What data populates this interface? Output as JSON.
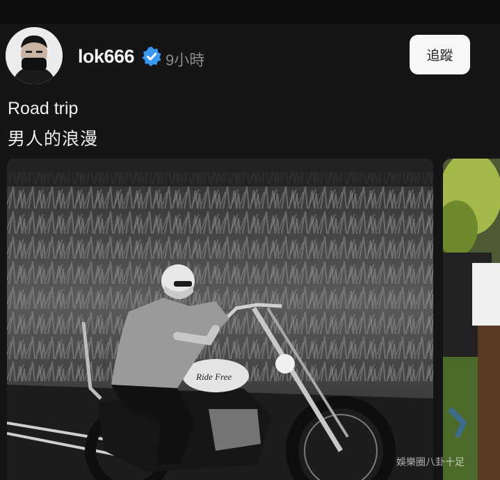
{
  "post": {
    "username": "lok666",
    "timestamp": "9小時",
    "follow_label": "追蹤",
    "caption_line1": "Road trip",
    "caption_line2": "男人的浪漫",
    "verified_icon": "verified-badge-icon",
    "verified_color": "#3897f0"
  },
  "media": {
    "tank_text": "Ride Free",
    "next_photo_icon": "partial-photo"
  },
  "watermark": "娛樂圈八卦十足"
}
